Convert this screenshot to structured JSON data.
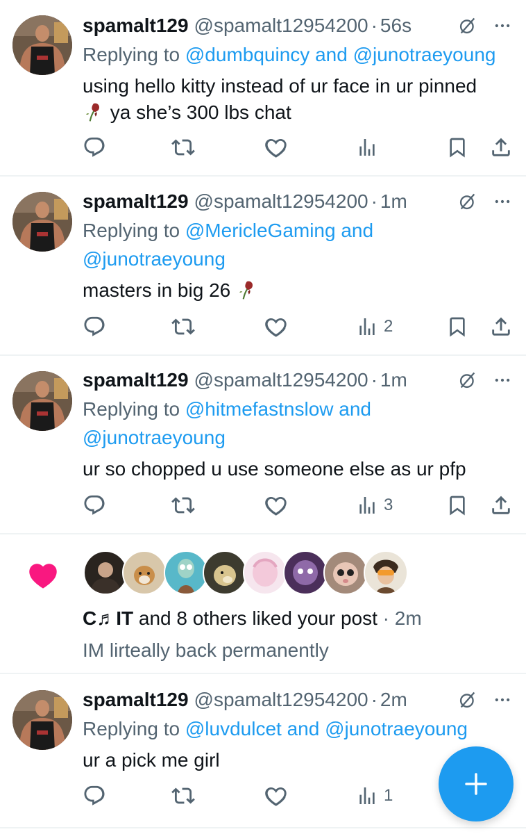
{
  "tweets": [
    {
      "name": "spamalt129",
      "handle": "@spamalt12954200",
      "time": "56s",
      "replying_prefix": "Replying to",
      "mention1": "@dumbquincy",
      "joiner": "and",
      "mention2": "@junotraeyoung",
      "text_line1": "using hello kitty instead of ur face in ur pinned",
      "text_line2": "ya she’s 300 lbs chat",
      "views": ""
    },
    {
      "name": "spamalt129",
      "handle": "@spamalt12954200",
      "time": "1m",
      "replying_prefix": "Replying to",
      "mention1": "@MericleGaming",
      "joiner": "and",
      "mention2": "@junotraeyoung",
      "text_line1": "masters in big 26",
      "views": "2"
    },
    {
      "name": "spamalt129",
      "handle": "@spamalt12954200",
      "time": "1m",
      "replying_prefix": "Replying to",
      "mention1": "@hitmefastnslow",
      "joiner": "and",
      "mention2": "@junotraeyoung",
      "text_line1": "ur so chopped u use someone else as ur pfp",
      "views": "3"
    },
    {
      "name": "spamalt129",
      "handle": "@spamalt12954200",
      "time": "2m",
      "replying_prefix": "Replying to",
      "mention1": "@luvdulcet",
      "joiner": "and",
      "mention2": "@junotraeyoung",
      "text_line1": "ur a pick me girl",
      "views": "1"
    }
  ],
  "notification": {
    "liker_name": "C♬IT",
    "action_text": "and 8 others liked your post",
    "time": "2m",
    "post_text": "IM lirteally back permanently",
    "heart_color": "#f91880"
  },
  "separator": "·",
  "icons": [
    "reply-icon",
    "retweet-icon",
    "like-icon",
    "views-icon",
    "bookmark-icon",
    "share-icon",
    "grok-icon",
    "more-icon",
    "compose-plus-icon"
  ],
  "colors": {
    "link": "#1d9bf0",
    "muted": "#536471",
    "fab": "#1d9bf0"
  }
}
